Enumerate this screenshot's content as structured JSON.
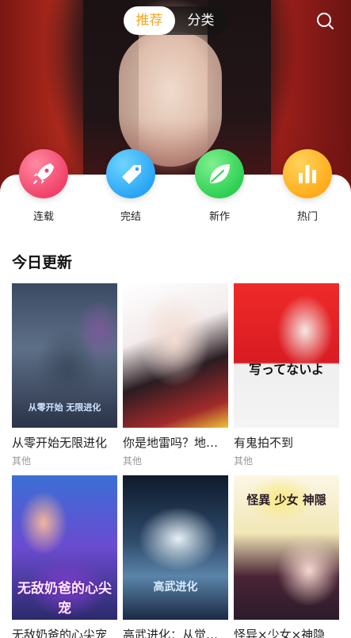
{
  "top_nav": {
    "tabs": [
      {
        "label": "推荐",
        "active": true
      },
      {
        "label": "分类",
        "active": false
      }
    ],
    "search_icon": "search-icon",
    "accent_color": "#f5a623"
  },
  "categories": [
    {
      "label": "连载",
      "icon": "rocket-icon",
      "color": "#f2426a"
    },
    {
      "label": "完结",
      "icon": "tag-icon",
      "color": "#2aa6f5"
    },
    {
      "label": "新作",
      "icon": "leaf-icon",
      "color": "#2fd154"
    },
    {
      "label": "热门",
      "icon": "bar-chart-icon",
      "color": "#ffac1c"
    }
  ],
  "section": {
    "title": "今日更新"
  },
  "comics": [
    {
      "title": "从零开始无限进化",
      "genre": "其他",
      "cover_text": "从零开始 无限进化"
    },
    {
      "title": "你是地雷吗？地…",
      "genre": "其他",
      "cover_text": ""
    },
    {
      "title": "有鬼拍不到",
      "genre": "其他",
      "cover_text": "写ってないよ"
    },
    {
      "title": "无敌奶爸的心尖宠",
      "genre": "",
      "cover_text": "无敌奶爸的心尖宠"
    },
    {
      "title": "高武进化：从觉…",
      "genre": "",
      "cover_text": "高武进化"
    },
    {
      "title": "怪异×少女×神隐",
      "genre": "",
      "cover_text": "怪異 少女 神隠"
    }
  ]
}
